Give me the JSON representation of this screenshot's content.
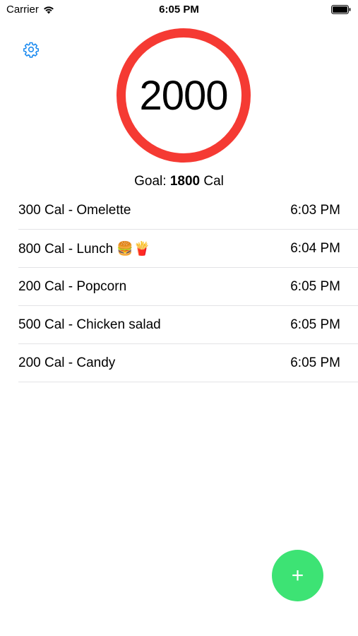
{
  "status_bar": {
    "carrier": "Carrier",
    "time": "6:05 PM"
  },
  "settings": {
    "icon": "gear-icon",
    "color": "#1e8cf0"
  },
  "summary": {
    "total": "2000",
    "ring_color": "#f53a33",
    "goal_prefix": "Goal: ",
    "goal_value": "1800",
    "goal_unit": " Cal"
  },
  "entries": [
    {
      "label": "300 Cal - Omelette",
      "time": "6:03 PM"
    },
    {
      "label": "800 Cal - Lunch 🍔🍟",
      "time": "6:04 PM"
    },
    {
      "label": "200 Cal - Popcorn",
      "time": "6:05 PM"
    },
    {
      "label": "500 Cal - Chicken salad",
      "time": "6:05 PM"
    },
    {
      "label": "200 Cal - Candy",
      "time": "6:05 PM"
    }
  ],
  "add_button": {
    "label": "+",
    "icon": "plus-icon",
    "color": "#3de374"
  }
}
